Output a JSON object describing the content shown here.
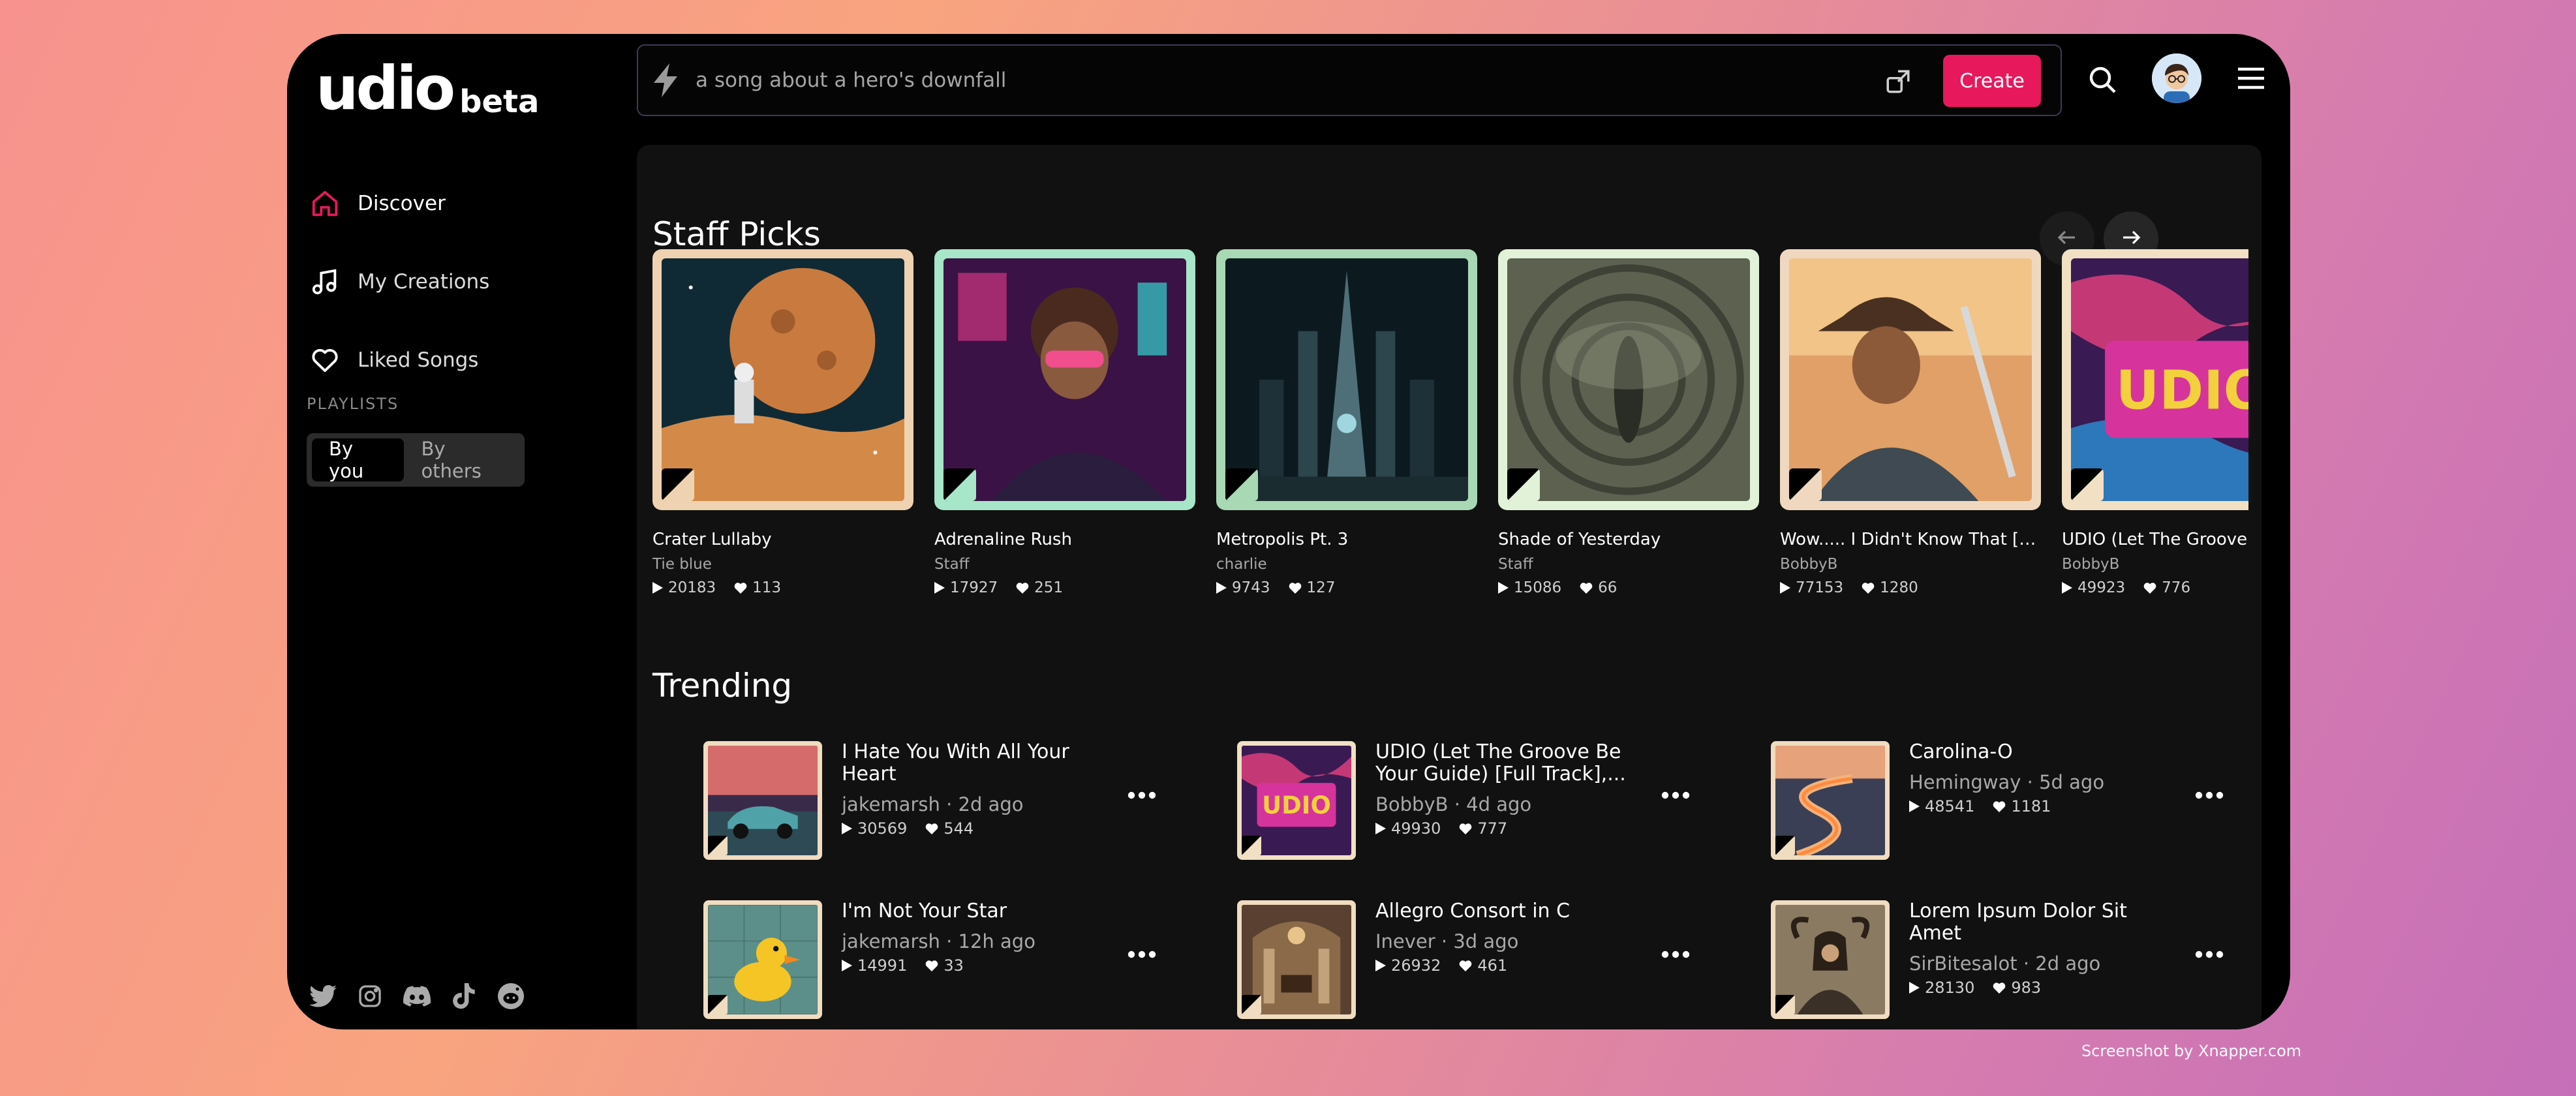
{
  "logo": {
    "main": "udio",
    "badge": "beta"
  },
  "nav": {
    "discover": "Discover",
    "my_creations": "My Creations",
    "liked_songs": "Liked Songs"
  },
  "playlists": {
    "label": "PLAYLISTS",
    "by_you": "By you",
    "by_others": "By others"
  },
  "search": {
    "placeholder": "a song about a hero's downfall",
    "create_label": "Create"
  },
  "staff_picks": {
    "title": "Staff Picks",
    "cards": [
      {
        "title": "Crater Lullaby",
        "artist": "Tie blue",
        "plays": "20183",
        "likes": "113"
      },
      {
        "title": "Adrenaline Rush",
        "artist": "Staff",
        "plays": "17927",
        "likes": "251"
      },
      {
        "title": "Metropolis Pt. 3",
        "artist": "charlie",
        "plays": "9743",
        "likes": "127"
      },
      {
        "title": "Shade of Yesterday",
        "artist": "Staff",
        "plays": "15086",
        "likes": "66"
      },
      {
        "title": "Wow..... I Didn't Know That [Full Track]",
        "artist": "BobbyB",
        "plays": "77153",
        "likes": "1280"
      },
      {
        "title": "UDIO (Let The Groove Be Your Guide)",
        "artist": "BobbyB",
        "plays": "49923",
        "likes": "776"
      }
    ]
  },
  "trending": {
    "title": "Trending",
    "items": [
      {
        "title": "I Hate You With All Your Heart",
        "artist": "jakemarsh",
        "ago": "2d ago",
        "plays": "30569",
        "likes": "544"
      },
      {
        "title": "UDIO (Let The Groove Be Your Guide) [Full Track],...",
        "artist": "BobbyB",
        "ago": "4d ago",
        "plays": "49930",
        "likes": "777"
      },
      {
        "title": "Carolina-O",
        "artist": "Hemingway",
        "ago": "5d ago",
        "plays": "48541",
        "likes": "1181"
      },
      {
        "title": "I'm Not Your Star",
        "artist": "jakemarsh",
        "ago": "12h ago",
        "plays": "14991",
        "likes": "33"
      },
      {
        "title": "Allegro Consort in C",
        "artist": "Inever",
        "ago": "3d ago",
        "plays": "26932",
        "likes": "461"
      },
      {
        "title": "Lorem Ipsum Dolor Sit Amet",
        "artist": "SirBitesalot",
        "ago": "2d ago",
        "plays": "28130",
        "likes": "983"
      }
    ]
  },
  "separator": "·",
  "credit": "Screenshot by Xnapper.com",
  "colors": {
    "accent": "#e8185c",
    "panel": "#111111",
    "frame": "#000000"
  },
  "icons": [
    "home-icon",
    "music-note-icon",
    "heart-icon",
    "bolt-icon",
    "share-icon",
    "search-icon",
    "menu-icon",
    "arrow-left-icon",
    "arrow-right-icon",
    "play-icon",
    "more-icon",
    "twitter-icon",
    "instagram-icon",
    "discord-icon",
    "tiktok-icon",
    "reddit-icon"
  ]
}
